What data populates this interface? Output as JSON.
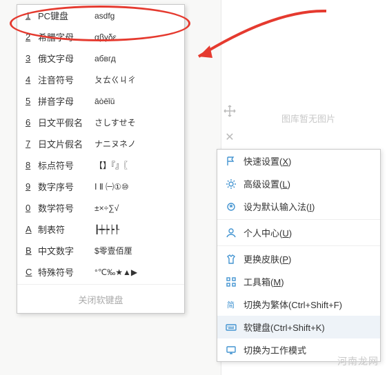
{
  "soft_keyboard_menu": {
    "items": [
      {
        "key": "1",
        "label": "PC键盘",
        "sample": "asdfg"
      },
      {
        "key": "2",
        "label": "希腊字母",
        "sample": "αβγδε"
      },
      {
        "key": "3",
        "label": "俄文字母",
        "sample": "абвгд"
      },
      {
        "key": "4",
        "label": "注音符号",
        "sample": "ㄆㄊㄍㄐㄔ"
      },
      {
        "key": "5",
        "label": "拼音字母",
        "sample": "āòēǐǔ"
      },
      {
        "key": "6",
        "label": "日文平假名",
        "sample": "さしすせそ"
      },
      {
        "key": "7",
        "label": "日文片假名",
        "sample": "ナニヌネノ"
      },
      {
        "key": "8",
        "label": "标点符号",
        "sample": "【】『』〖"
      },
      {
        "key": "9",
        "label": "数字序号",
        "sample": "Ⅰ Ⅱ ㈠①⑩"
      },
      {
        "key": "0",
        "label": "数学符号",
        "sample": "±×÷∑√"
      },
      {
        "key": "A",
        "label": "制表符",
        "sample": "┠┿┾┝┞"
      },
      {
        "key": "B",
        "label": "中文数字",
        "sample": "$零壹佰厘"
      },
      {
        "key": "C",
        "label": "特殊符号",
        "sample": "°℃‰★▲▶"
      }
    ],
    "close_label": "关闭软键盘"
  },
  "placeholder_text": "图库暂无图片",
  "context_menu": {
    "items": [
      {
        "icon": "flag",
        "label": "快速设置",
        "accel": "X"
      },
      {
        "icon": "gear",
        "label": "高级设置",
        "accel": "L"
      },
      {
        "icon": "star",
        "label": "设为默认输入法",
        "accel": "I"
      },
      {
        "divider": true
      },
      {
        "icon": "user",
        "label": "个人中心",
        "accel": "U"
      },
      {
        "divider": true
      },
      {
        "icon": "shirt",
        "label": "更换皮肤",
        "accel": "P"
      },
      {
        "icon": "grid",
        "label": "工具箱",
        "accel": "M"
      },
      {
        "icon": "cn",
        "label": "切换为繁体",
        "hint": "(Ctrl+Shift+F)"
      },
      {
        "icon": "kbd",
        "label": "软键盘",
        "hint": "(Ctrl+Shift+K)",
        "highlight": true
      },
      {
        "icon": "monitor",
        "label": "切换为工作模式"
      }
    ]
  },
  "watermark": "河南龙网"
}
